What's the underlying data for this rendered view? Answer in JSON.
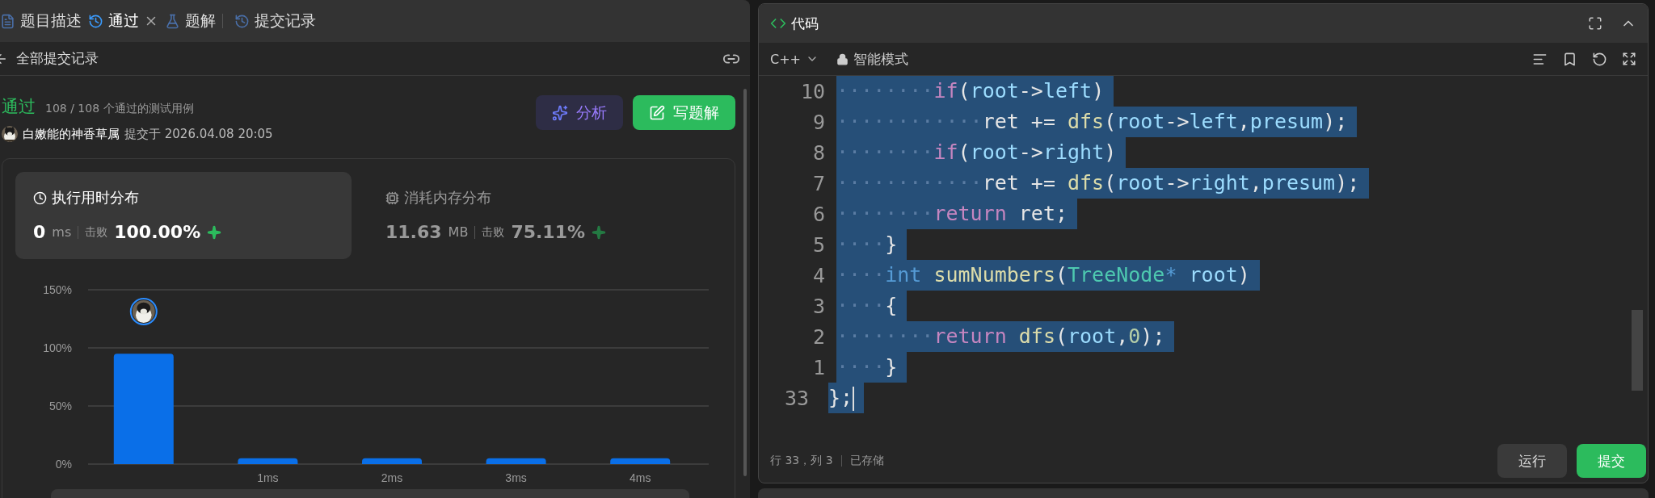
{
  "left_panel": {
    "tabs": [
      {
        "kind": "description",
        "label": "题目描述",
        "selected": false,
        "closable": false
      },
      {
        "kind": "result",
        "label": "通过",
        "selected": true,
        "closable": true
      },
      {
        "kind": "solution",
        "label": "题解",
        "selected": false,
        "closable": false
      },
      {
        "kind": "history",
        "label": "提交记录",
        "selected": false,
        "closable": false
      }
    ],
    "back_link": "全部提交记录",
    "status": "通过",
    "testcases": "108 / 108 个通过的测试用例",
    "user": "白嫩能的神香草属",
    "submitted": "提交于 2026.04.08 20:05",
    "buttons": [
      {
        "kind": "analyze",
        "label": "分析"
      },
      {
        "kind": "write",
        "label": "写题解"
      }
    ],
    "metrics": [
      {
        "kind": "time",
        "title": "执行用时分布",
        "value": "0",
        "unit": "ms",
        "beats_label": "击败",
        "beats": "100.00%",
        "selected": true
      },
      {
        "kind": "memory",
        "title": "消耗内存分布",
        "value": "11.63",
        "unit": "MB",
        "beats_label": "击败",
        "beats": "75.11%",
        "selected": false
      }
    ],
    "chart_data": {
      "type": "bar",
      "categories": [
        null,
        "1ms",
        "2ms",
        "3ms",
        "4ms"
      ],
      "series": [
        {
          "color": "#0a6fe8",
          "values": [
            95,
            5,
            5,
            5,
            5
          ]
        }
      ],
      "ylim": [
        0,
        150
      ],
      "yticks": [
        {
          "value": 0,
          "label": "0%"
        },
        {
          "value": 50,
          "label": "50%"
        },
        {
          "value": 100,
          "label": "100%"
        },
        {
          "value": 150,
          "label": "150%"
        }
      ]
    }
  },
  "editor": {
    "title": "代码",
    "language": "C++",
    "mode": "智能模式",
    "lines": [
      {
        "number": "10",
        "selected": true,
        "tokens": [
          {
            "kind": "ws",
            "text": "········"
          },
          {
            "kind": "kw",
            "text": "if"
          },
          {
            "kind": "p",
            "text": "("
          },
          {
            "kind": "var",
            "text": "root"
          },
          {
            "kind": "p",
            "text": "->"
          },
          {
            "kind": "var",
            "text": "left"
          },
          {
            "kind": "p",
            "text": ")"
          }
        ]
      },
      {
        "number": "9",
        "selected": true,
        "tokens": [
          {
            "kind": "ws",
            "text": "············"
          },
          {
            "kind": "plain",
            "text": "ret += "
          },
          {
            "kind": "fn",
            "text": "dfs"
          },
          {
            "kind": "p",
            "text": "("
          },
          {
            "kind": "var",
            "text": "root"
          },
          {
            "kind": "p",
            "text": "->"
          },
          {
            "kind": "var",
            "text": "left"
          },
          {
            "kind": "p",
            "text": ","
          },
          {
            "kind": "var",
            "text": "presum"
          },
          {
            "kind": "p",
            "text": ");"
          }
        ]
      },
      {
        "number": "8",
        "selected": true,
        "tokens": [
          {
            "kind": "ws",
            "text": "········"
          },
          {
            "kind": "kw",
            "text": "if"
          },
          {
            "kind": "p",
            "text": "("
          },
          {
            "kind": "var",
            "text": "root"
          },
          {
            "kind": "p",
            "text": "->"
          },
          {
            "kind": "var",
            "text": "right"
          },
          {
            "kind": "p",
            "text": ")"
          }
        ]
      },
      {
        "number": "7",
        "selected": true,
        "tokens": [
          {
            "kind": "ws",
            "text": "············"
          },
          {
            "kind": "plain",
            "text": "ret += "
          },
          {
            "kind": "fn",
            "text": "dfs"
          },
          {
            "kind": "p",
            "text": "("
          },
          {
            "kind": "var",
            "text": "root"
          },
          {
            "kind": "p",
            "text": "->"
          },
          {
            "kind": "var",
            "text": "right"
          },
          {
            "kind": "p",
            "text": ","
          },
          {
            "kind": "var",
            "text": "presum"
          },
          {
            "kind": "p",
            "text": ");"
          }
        ]
      },
      {
        "number": "6",
        "selected": true,
        "tokens": [
          {
            "kind": "ws",
            "text": "········"
          },
          {
            "kind": "kw",
            "text": "return"
          },
          {
            "kind": "plain",
            "text": " ret;"
          }
        ]
      },
      {
        "number": "5",
        "selected": true,
        "tokens": [
          {
            "kind": "ws",
            "text": "····"
          },
          {
            "kind": "p",
            "text": "}"
          }
        ]
      },
      {
        "number": "4",
        "selected": true,
        "tokens": [
          {
            "kind": "ws",
            "text": "····"
          },
          {
            "kind": "type",
            "text": "int"
          },
          {
            "kind": "fn",
            "text": " sumNumbers"
          },
          {
            "kind": "p",
            "text": "("
          },
          {
            "kind": "cls",
            "text": "TreeNode"
          },
          {
            "kind": "type",
            "text": "*"
          },
          {
            "kind": "var",
            "text": " root"
          },
          {
            "kind": "p",
            "text": ")"
          }
        ]
      },
      {
        "number": "3",
        "selected": true,
        "tokens": [
          {
            "kind": "ws",
            "text": "····"
          },
          {
            "kind": "p",
            "text": "{"
          }
        ]
      },
      {
        "number": "2",
        "selected": true,
        "tokens": [
          {
            "kind": "ws",
            "text": "········"
          },
          {
            "kind": "kw",
            "text": "return"
          },
          {
            "kind": "fn",
            "text": " dfs"
          },
          {
            "kind": "p",
            "text": "("
          },
          {
            "kind": "var",
            "text": "root"
          },
          {
            "kind": "p",
            "text": ","
          },
          {
            "kind": "num",
            "text": "0"
          },
          {
            "kind": "p",
            "text": ");"
          }
        ]
      },
      {
        "number": "1",
        "selected": true,
        "tokens": [
          {
            "kind": "ws",
            "text": "····"
          },
          {
            "kind": "p",
            "text": "}"
          }
        ]
      },
      {
        "number": "33",
        "selected": true,
        "tokens": [
          {
            "kind": "p",
            "text": "};"
          }
        ]
      }
    ],
    "position": "行 33，列 3",
    "saved": "已存储",
    "buttons": [
      {
        "kind": "run",
        "label": "运行"
      },
      {
        "kind": "submit",
        "label": "提交"
      }
    ]
  }
}
